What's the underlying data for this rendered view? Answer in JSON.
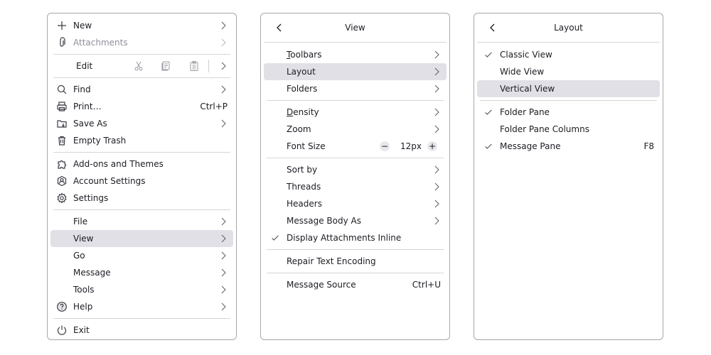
{
  "main_menu": {
    "items": [
      {
        "type": "item",
        "label": "New",
        "icon": "plus-icon",
        "submenu": true
      },
      {
        "type": "item",
        "label": "Attachments",
        "icon": "paperclip-icon",
        "submenu": true,
        "disabled": true
      },
      {
        "type": "sep"
      },
      {
        "type": "edit",
        "label": "Edit",
        "tools": [
          "cut-icon",
          "copy-icon",
          "paste-icon"
        ]
      },
      {
        "type": "sep"
      },
      {
        "type": "item",
        "label": "Find",
        "icon": "search-icon",
        "submenu": true
      },
      {
        "type": "item",
        "label": "Print…",
        "icon": "printer-icon",
        "shortcut": "Ctrl+P"
      },
      {
        "type": "item",
        "label": "Save As",
        "icon": "save-folder-icon",
        "submenu": true
      },
      {
        "type": "item",
        "label": "Empty Trash",
        "icon": "trash-icon"
      },
      {
        "type": "sep"
      },
      {
        "type": "item",
        "label": "Add-ons and Themes",
        "icon": "puzzle-icon"
      },
      {
        "type": "item",
        "label": "Account Settings",
        "icon": "account-icon"
      },
      {
        "type": "item",
        "label": "Settings",
        "icon": "gear-icon"
      },
      {
        "type": "sep"
      },
      {
        "type": "item",
        "label": "File",
        "submenu": true
      },
      {
        "type": "item",
        "label": "View",
        "submenu": true,
        "highlighted": true
      },
      {
        "type": "item",
        "label": "Go",
        "submenu": true
      },
      {
        "type": "item",
        "label": "Message",
        "submenu": true
      },
      {
        "type": "item",
        "label": "Tools",
        "submenu": true
      },
      {
        "type": "item",
        "label": "Help",
        "icon": "help-icon",
        "submenu": true
      },
      {
        "type": "sep"
      },
      {
        "type": "item",
        "label": "Exit",
        "icon": "power-icon"
      }
    ]
  },
  "view_menu": {
    "title": "View",
    "items": [
      {
        "type": "item",
        "label": "Toolbars",
        "submenu": true,
        "underline": true
      },
      {
        "type": "item",
        "label": "Layout",
        "submenu": true,
        "highlighted": true
      },
      {
        "type": "item",
        "label": "Folders",
        "submenu": true
      },
      {
        "type": "sep"
      },
      {
        "type": "item",
        "label": "Density",
        "submenu": true,
        "underline": true
      },
      {
        "type": "item",
        "label": "Zoom",
        "submenu": true
      },
      {
        "type": "fontsize",
        "label": "Font Size",
        "value": "12px",
        "minus": "−",
        "plus": "+"
      },
      {
        "type": "sep"
      },
      {
        "type": "item",
        "label": "Sort by",
        "submenu": true
      },
      {
        "type": "item",
        "label": "Threads",
        "submenu": true
      },
      {
        "type": "item",
        "label": "Headers",
        "submenu": true
      },
      {
        "type": "item",
        "label": "Message Body As",
        "submenu": true
      },
      {
        "type": "item",
        "label": "Display Attachments Inline",
        "checked": true
      },
      {
        "type": "sep"
      },
      {
        "type": "item",
        "label": "Repair Text Encoding"
      },
      {
        "type": "sep"
      },
      {
        "type": "item",
        "label": "Message Source",
        "shortcut": "Ctrl+U"
      }
    ]
  },
  "layout_menu": {
    "title": "Layout",
    "items": [
      {
        "type": "item",
        "label": "Classic View",
        "checked": true
      },
      {
        "type": "item",
        "label": "Wide View"
      },
      {
        "type": "item",
        "label": "Vertical View",
        "highlighted": true
      },
      {
        "type": "sep"
      },
      {
        "type": "item",
        "label": "Folder Pane",
        "checked": true
      },
      {
        "type": "item",
        "label": "Folder Pane Columns"
      },
      {
        "type": "item",
        "label": "Message Pane",
        "checked": true,
        "shortcut": "F8"
      }
    ]
  },
  "colors": {
    "highlight": "#e0e0e6",
    "border": "#a8a8a8",
    "separator": "#d6d6d6",
    "text": "#1c1b22",
    "disabled": "#8f8f9d"
  }
}
